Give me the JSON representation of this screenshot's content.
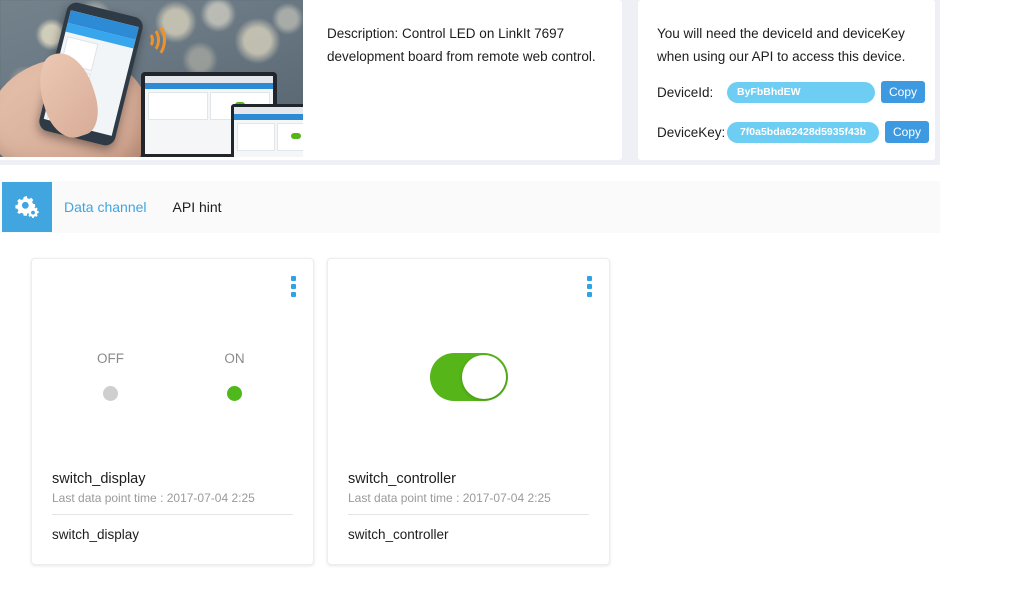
{
  "info_panel": {
    "description": "Description: Control LED on LinkIt 7697 development board from remote web control.",
    "hero_image_alt": "hand-holding-phone-with-laptop-and-tablet"
  },
  "api_panel": {
    "note": "You will need the deviceId and deviceKey when using our API to access this device.",
    "device_id_label": "DeviceId:",
    "device_id_value": "ByFbBhdEW",
    "device_key_label": "DeviceKey:",
    "device_key_value": "7f0a5bda62428d5935f43b",
    "copy_label": "Copy"
  },
  "tabbar": {
    "gear_icon": "cogs-icon",
    "tabs": [
      {
        "label": "Data channel",
        "active": true
      },
      {
        "label": "API hint",
        "active": false
      }
    ]
  },
  "cards": [
    {
      "menu_icon": "kebab-menu-icon",
      "widget": "on-off-indicator",
      "off_label": "OFF",
      "on_label": "ON",
      "state": "ON",
      "title": "switch_display",
      "subtitle": "Last data point time : 2017-07-04 2:25",
      "channel_name": "switch_display"
    },
    {
      "menu_icon": "kebab-menu-icon",
      "widget": "toggle-switch",
      "state": "on",
      "title": "switch_controller",
      "subtitle": "Last data point time : 2017-07-04 2:25",
      "channel_name": "switch_controller"
    }
  ],
  "colors": {
    "page_bg": "#eef0f5",
    "accent_blue": "#41a5e0",
    "pill_blue": "#6ecdf3",
    "copy_blue": "#3d9ae0",
    "green_on": "#55b519",
    "dot_off": "#cfcfcf",
    "dot_on": "#4fb81b"
  }
}
